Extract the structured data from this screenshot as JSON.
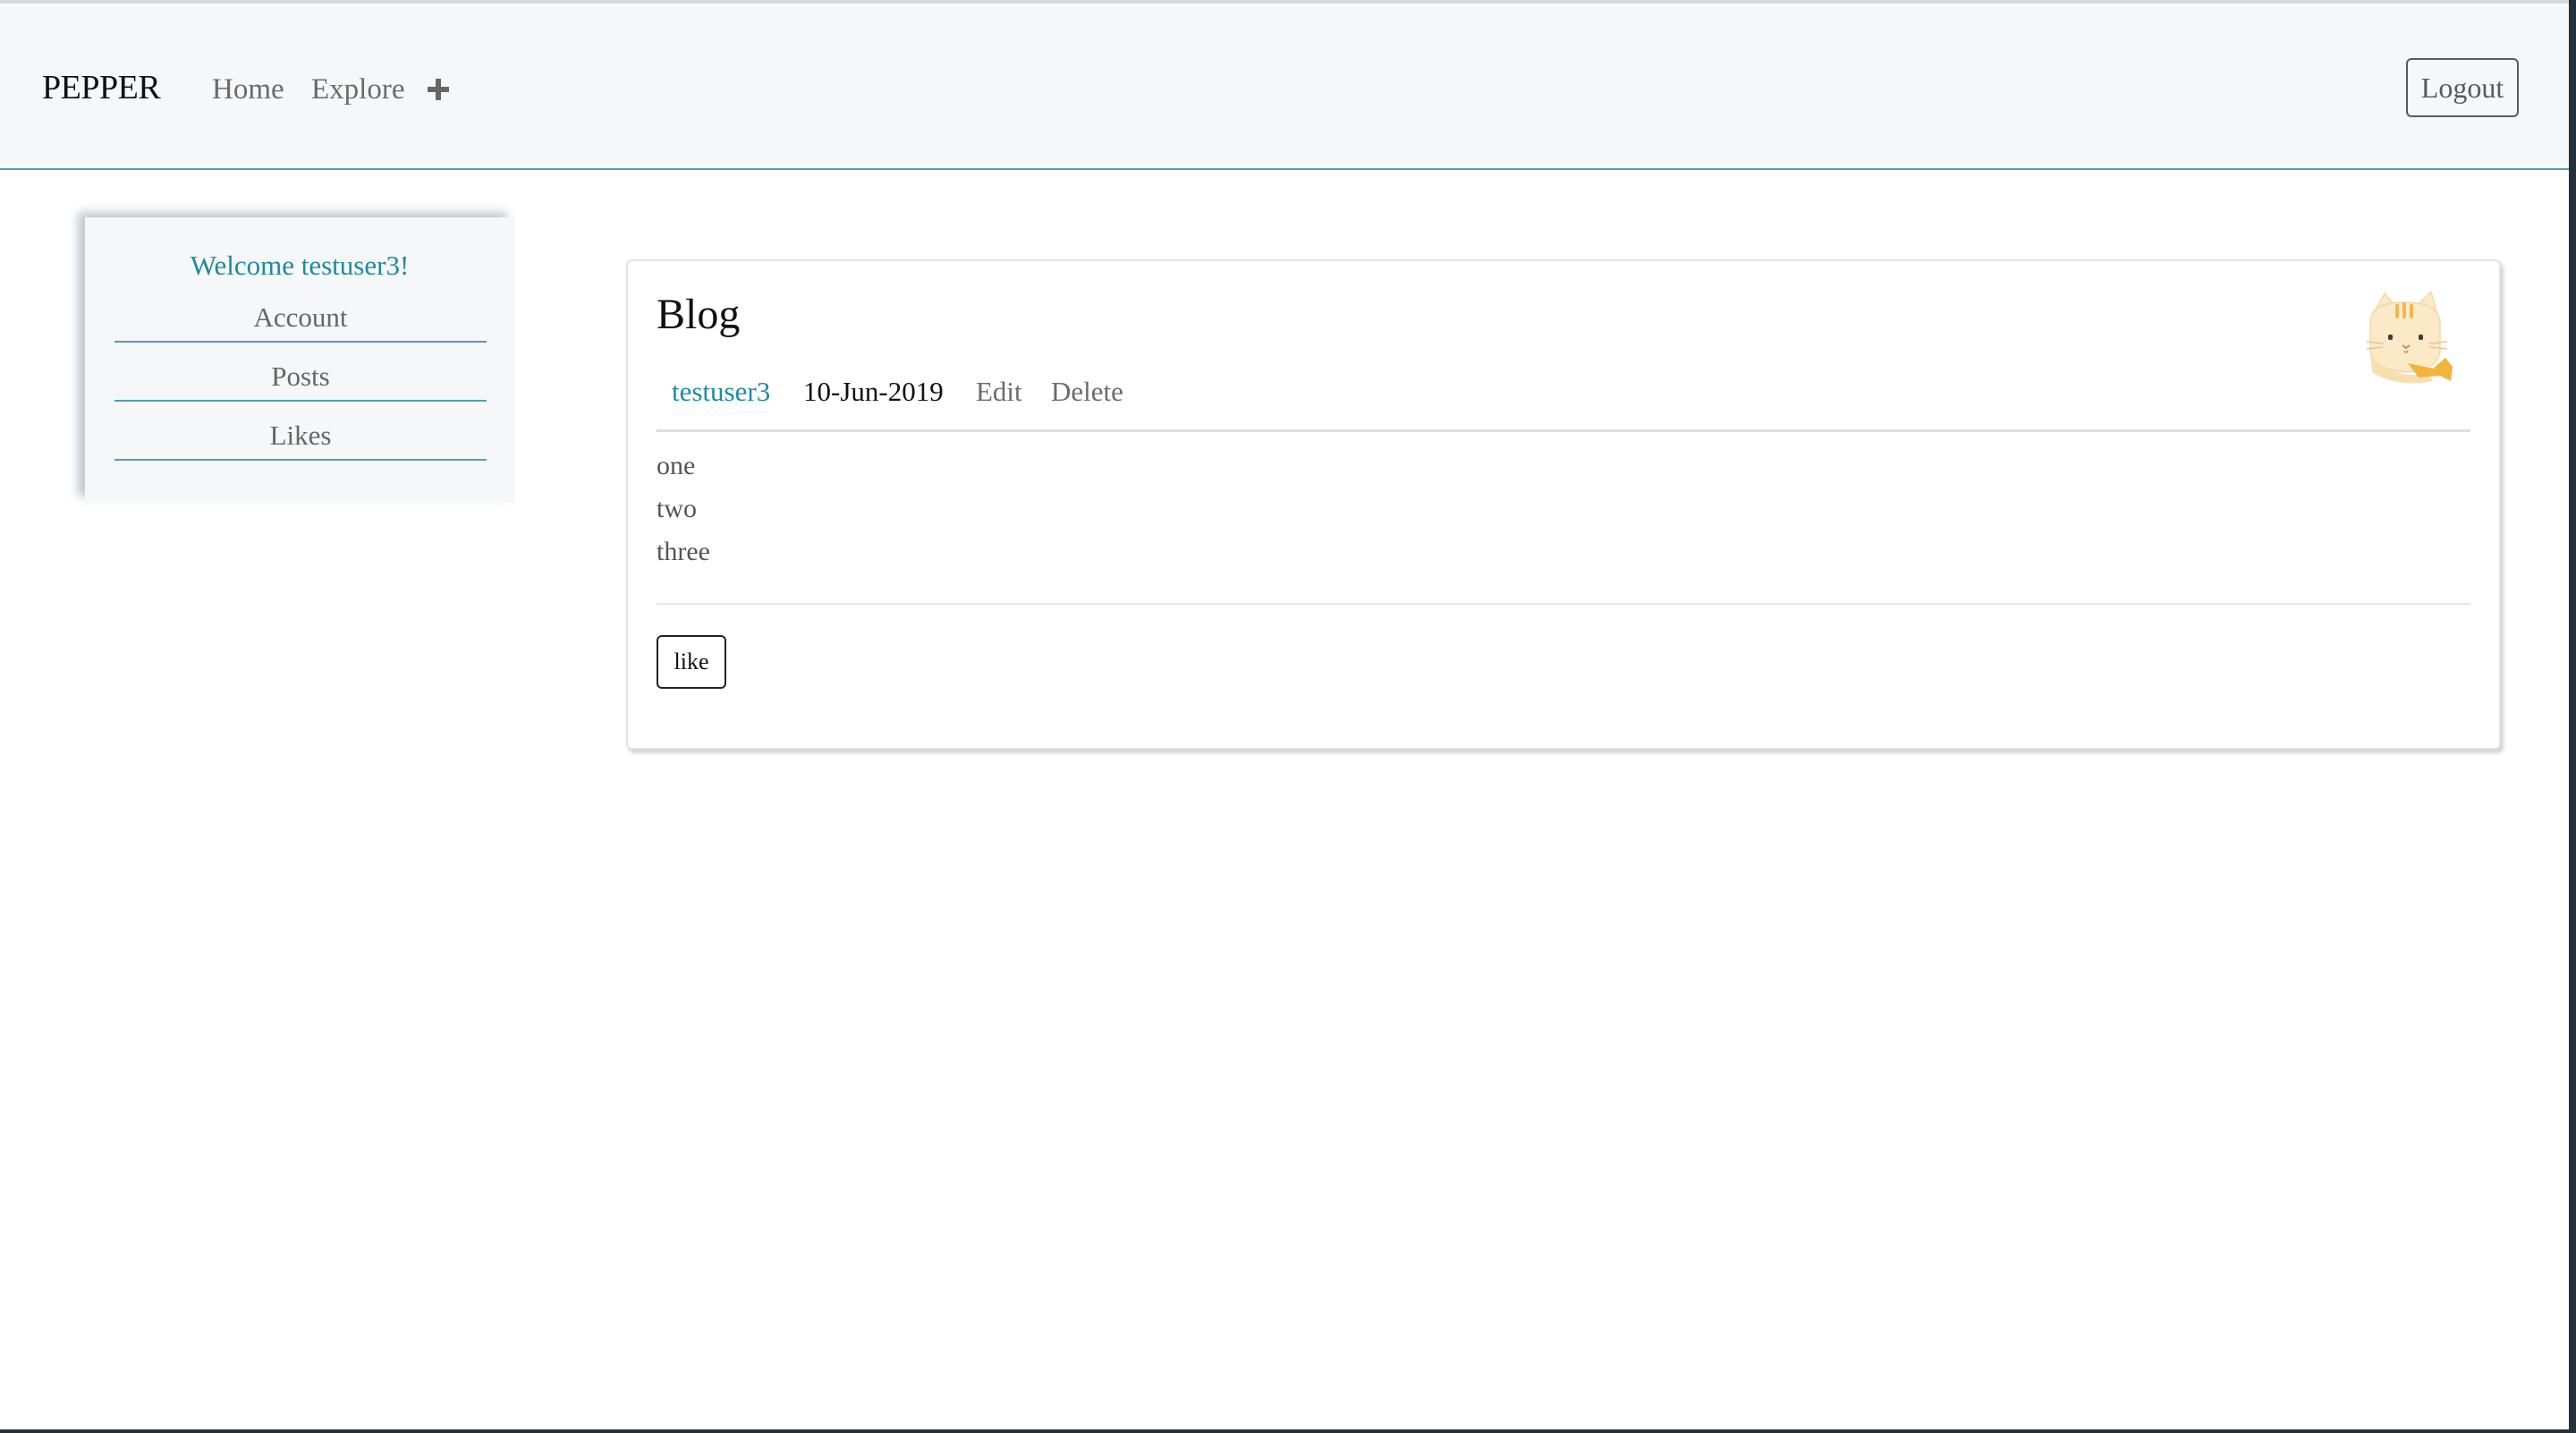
{
  "navbar": {
    "brand": "PEPPER",
    "links": [
      "Home",
      "Explore"
    ],
    "add_icon": "plus-icon",
    "logout_label": "Logout"
  },
  "sidebar": {
    "welcome": "Welcome testuser3!",
    "items": [
      {
        "label": "Account"
      },
      {
        "label": "Posts"
      },
      {
        "label": "Likes"
      }
    ]
  },
  "post": {
    "title": "Blog",
    "author": "testuser3",
    "date": "10-Jun-2019",
    "edit_label": "Edit",
    "delete_label": "Delete",
    "body_lines": [
      "one",
      "two",
      "three"
    ],
    "like_label": "like",
    "avatar_icon": "cat-avatar-icon"
  },
  "colors": {
    "accent": "#1d8aa0",
    "navbar_bg": "#f6f7f8",
    "divider": "#5a9fb0"
  }
}
